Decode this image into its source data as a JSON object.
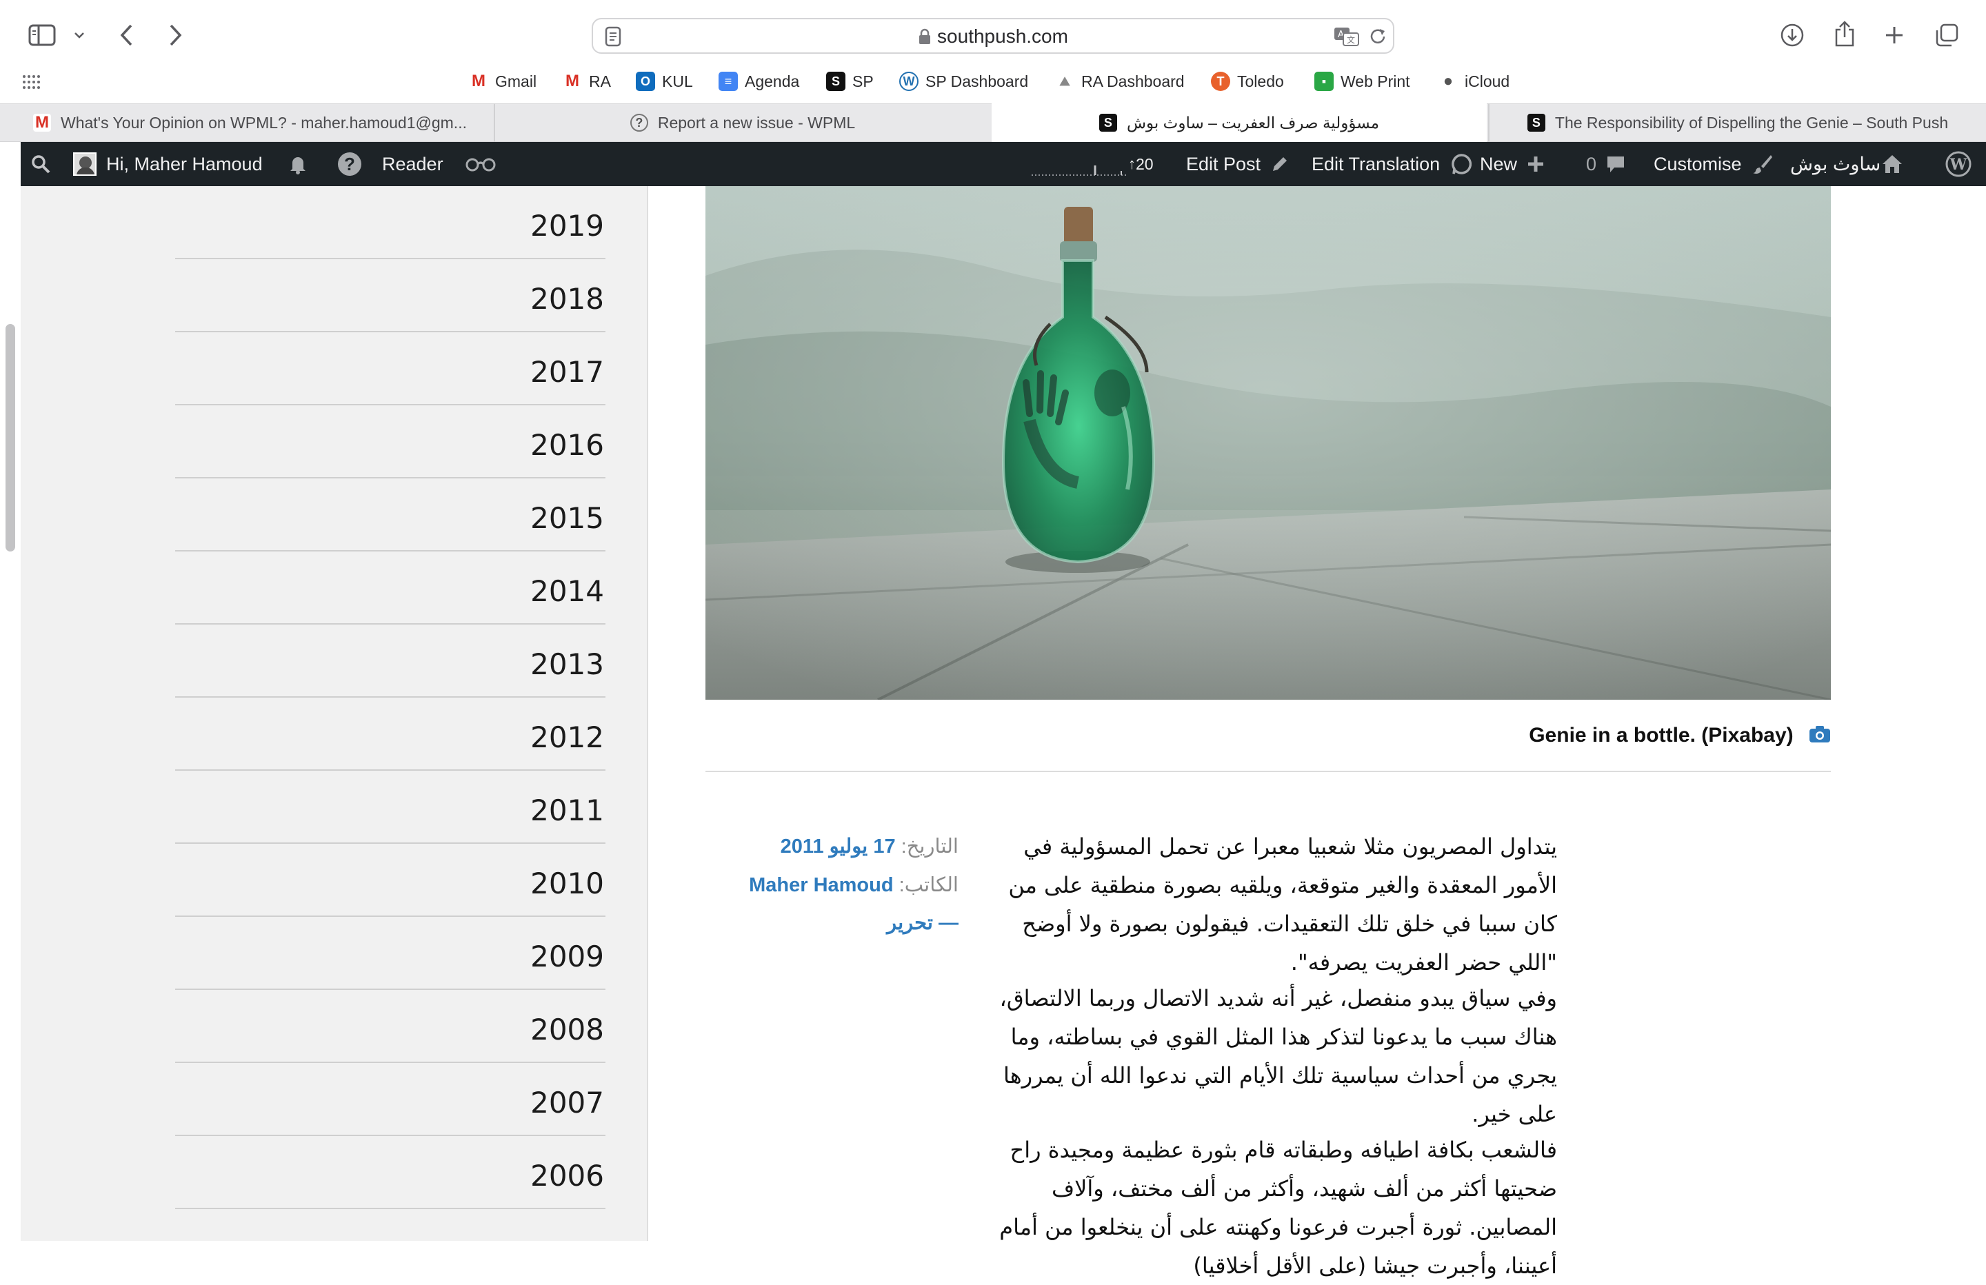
{
  "browser": {
    "url": "southpush.com",
    "bookmarks": [
      "Gmail",
      "RA",
      "KUL",
      "Agenda",
      "SP",
      "SP Dashboard",
      "RA Dashboard",
      "Toledo",
      "Web Print",
      "iCloud"
    ],
    "tabs": [
      {
        "title": "What's Your Opinion on WPML? - maher.hamoud1@gm...",
        "icon": "gmail-icon"
      },
      {
        "title": "Report a new issue - WPML",
        "icon": "wpml-icon"
      },
      {
        "title": "مسؤولية صرف العفريت – ساوث بوش",
        "icon": "southpush-icon"
      },
      {
        "title": "The Responsibility of Dispelling the Genie – South Push",
        "icon": "southpush-icon"
      }
    ],
    "active_tab": 2
  },
  "wp_admin_bar": {
    "greeting": "Hi, Maher Hamoud",
    "reader": "Reader",
    "counter": "20",
    "edit_post": "Edit Post",
    "edit_translation": "Edit Translation",
    "new": "New",
    "comments_count": "0",
    "customise": "Customise",
    "site_name": "ساوث بوش"
  },
  "archive_years": [
    "2019",
    "2018",
    "2017",
    "2016",
    "2015",
    "2014",
    "2013",
    "2012",
    "2011",
    "2010",
    "2009",
    "2008",
    "2007",
    "2006"
  ],
  "post": {
    "image_caption": "Genie in a bottle. (Pixabay)",
    "date_label": "التاريخ:",
    "date_value": "17 يوليو 2011",
    "author_label": "الكاتب:",
    "author_value": "Maher Hamoud",
    "edit_link": "— تحرير",
    "paragraphs": [
      "يتداول المصريون مثلا شعبيا معبرا عن تحمل المسؤولية في الأمور المعقدة والغير متوقعة، ويلقيه بصورة منطقية على من كان سببا في خلق تلك التعقيدات. فيقولون بصورة ولا أوضح \"اللي حضر العفريت يصرفه\".",
      "وفي سياق يبدو منفصل، غير أنه شديد الاتصال وربما الالتصاق، هناك سبب ما يدعونا لتذكر هذا المثل القوي في بساطته، وما يجري من أحداث سياسية تلك الأيام التي ندعوا الله أن يمررها على خير.",
      "فالشعب بكافة اطيافه وطبقاته قام بثورة عظيمة ومجيدة راح ضحيتها أكثر من ألف شهيد، وأكثر من ألف مختف، وآلاف المصابين. ثورة أجبرت فرعونا وكهنته على أن ينخلعوا من أمام أعيننا، وأجبرت جيشا (على الأقل أخلاقيا)"
    ]
  },
  "colors": {
    "wp_bar": "#1d2327",
    "link": "#2f7bbd",
    "sidebar_bg": "#f1f1f1"
  }
}
